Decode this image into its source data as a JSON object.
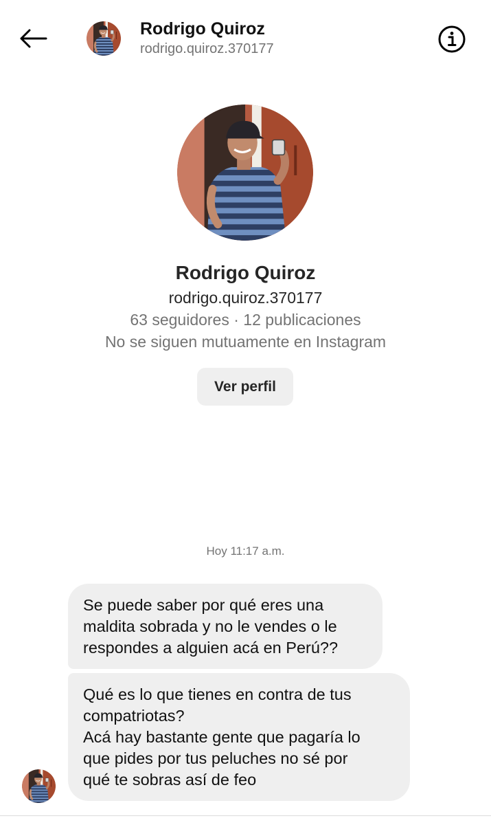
{
  "header": {
    "back_icon": "arrow-left-icon",
    "name": "Rodrigo Quiroz",
    "handle": "rodrigo.quiroz.370177",
    "info_icon": "info-circle-icon"
  },
  "profile": {
    "name": "Rodrigo Quiroz",
    "handle": "rodrigo.quiroz.370177",
    "stats": "63 seguidores · 12 publicaciones",
    "mutual": "No se siguen mutuamente en Instagram",
    "view_profile_label": "Ver perfil"
  },
  "conversation": {
    "timestamp": "Hoy 11:17 a.m.",
    "messages": [
      {
        "text": "Se puede saber por qué eres una\nmaldita sobrada y no le vendes o le\nrespondes a alguien acá en Perú??"
      },
      {
        "text": "Qué es lo que tienes en contra de tus\ncompatriotas?\nAcá hay bastante gente que pagaría lo\nque pides por tus peluches no sé por\nqué te sobras así de feo"
      }
    ]
  },
  "colors": {
    "bubble_bg": "#efefef",
    "secondary_text": "#737373",
    "primary_text": "#262626"
  }
}
